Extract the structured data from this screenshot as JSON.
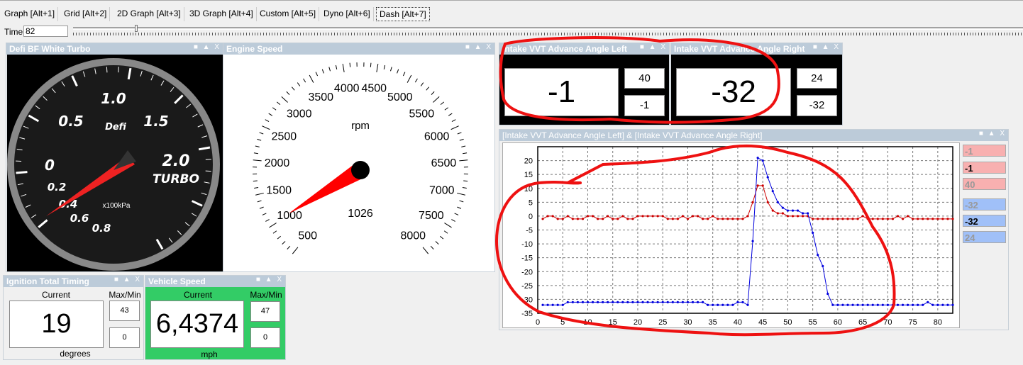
{
  "tabs": [
    "Graph [Alt+1]",
    "Grid [Alt+2]",
    "2D Graph [Alt+3]",
    "3D Graph [Alt+4]",
    "Custom [Alt+5]",
    "Dyno [Alt+6]",
    "Dash [Alt+7]"
  ],
  "time": {
    "label": "Time",
    "value": "82"
  },
  "panel_buttons": "■ ▲ X",
  "defi": {
    "title": "Defi BF White Turbo",
    "labels": [
      "1.0",
      "0.5",
      "1.5",
      "0",
      "2.0",
      "TURBO",
      "0.2",
      "0.4",
      "0.6",
      "0.8",
      "x100kPa",
      "Defi"
    ]
  },
  "engine": {
    "title": "Engine Speed",
    "unit": "rpm",
    "value": "1026",
    "rpm": 1026,
    "labels": [
      "500",
      "1000",
      "1500",
      "2000",
      "2500",
      "3000",
      "3500",
      "4000",
      "4500",
      "5000",
      "5500",
      "6000",
      "6500",
      "7000",
      "7500",
      "8000"
    ]
  },
  "vvt_left": {
    "title": "Intake VVT Advance Angle Left",
    "current": "-1",
    "max": "40",
    "min": "-1"
  },
  "vvt_right": {
    "title": "Intake VVT Advance Angle Right",
    "current": "-32",
    "max": "24",
    "min": "-32"
  },
  "ignition": {
    "title": "Ignition Total Timing",
    "current_label": "Current",
    "maxmin_label": "Max/Min",
    "current": "19",
    "max": "43",
    "min": "0",
    "unit": "degrees"
  },
  "speed": {
    "title": "Vehicle Speed",
    "current_label": "Current",
    "maxmin_label": "Max/Min",
    "current": "6,4374",
    "max": "47",
    "min": "0",
    "unit": "mph"
  },
  "chart_data": {
    "type": "line",
    "title": "[Intake VVT Advance Angle Left] & [Intake VVT Advance Angle Right]",
    "xlim": [
      0,
      83
    ],
    "ylim": [
      -35,
      25
    ],
    "xticks": [
      "0",
      "5",
      "10",
      "15",
      "20",
      "25",
      "30",
      "35",
      "40",
      "45",
      "50",
      "55",
      "60",
      "65",
      "70",
      "75",
      "80"
    ],
    "yticks": [
      "20",
      "15",
      "10",
      "5",
      "0",
      "-5",
      "-10",
      "-15",
      "-20",
      "-25",
      "-30",
      "-35"
    ],
    "grid": true,
    "series": [
      {
        "name": "Intake VVT Advance Angle Left",
        "color": "#cc0000",
        "legend": [
          "-1",
          "-1",
          "40"
        ],
        "legend_color": "#f8b0b0",
        "values": [
          -1,
          0,
          0,
          -1,
          -1,
          0,
          -1,
          -1,
          -1,
          0,
          0,
          -1,
          -1,
          0,
          -1,
          -1,
          0,
          -1,
          -1,
          0,
          0,
          0,
          0,
          0,
          0,
          -1,
          -1,
          -1,
          0,
          -1,
          0,
          0,
          -1,
          -1,
          0,
          -1,
          -1,
          -1,
          -1,
          -1,
          -1,
          0,
          5,
          11,
          11,
          5,
          2,
          1,
          1,
          0,
          0,
          0,
          0,
          0,
          -1,
          -1,
          -1,
          -1,
          -1,
          -1,
          -1,
          -1,
          -1,
          -1,
          0,
          -1,
          -1,
          -1,
          -1,
          -1,
          -1,
          0,
          -1,
          0,
          -1,
          -1,
          -1,
          -1,
          -1,
          -1,
          -1,
          -1,
          -1
        ]
      },
      {
        "name": "Intake VVT Advance Angle Right",
        "color": "#0000dd",
        "legend": [
          "-32",
          "-32",
          "24"
        ],
        "legend_color": "#a0c0f8",
        "values": [
          -32,
          -32,
          -32,
          -32,
          -32,
          -31,
          -31,
          -31,
          -31,
          -31,
          -31,
          -31,
          -31,
          -31,
          -31,
          -31,
          -31,
          -31,
          -31,
          -31,
          -31,
          -31,
          -31,
          -31,
          -31,
          -31,
          -31,
          -31,
          -31,
          -31,
          -31,
          -31,
          -31,
          -32,
          -32,
          -32,
          -32,
          -32,
          -32,
          -31,
          -31,
          -32,
          -9,
          21,
          20,
          14,
          9,
          5,
          3,
          2,
          2,
          2,
          1,
          1,
          -6,
          -14,
          -18,
          -28,
          -32,
          -32,
          -32,
          -32,
          -32,
          -32,
          -32,
          -32,
          -32,
          -32,
          -32,
          -32,
          -32,
          -32,
          -32,
          -32,
          -32,
          -32,
          -32,
          -31,
          -32,
          -32,
          -32,
          -32,
          -32
        ]
      }
    ]
  },
  "colors": {
    "titlebar": "#bccbd9",
    "speed_bg": "#33cc66",
    "annotation": "#ee1111"
  }
}
